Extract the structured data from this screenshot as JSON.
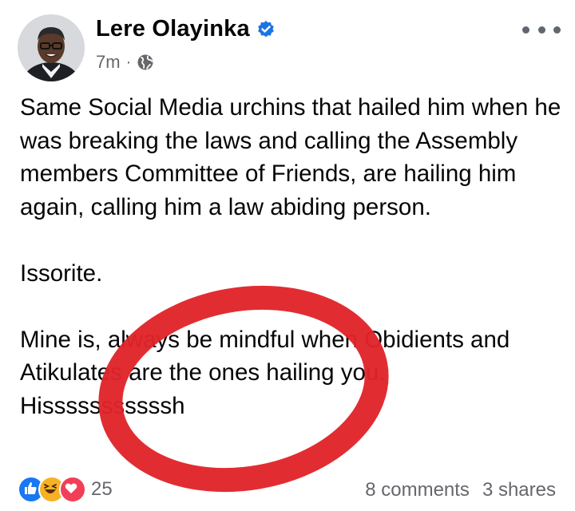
{
  "post": {
    "author": "Lere Olayinka",
    "time": "7m",
    "separator": "·",
    "paragraphs": [
      "Same Social Media urchins that hailed him when he was breaking the laws and calling the Assembly members Committee of Friends,  are hailing him again,  calling him a law abiding person.",
      "Issorite.",
      "Mine is, always be mindful when Obidients and Atikulates are the ones hailing you.\nHisssssssssssh"
    ],
    "reaction_count": "25",
    "comments": "8 comments",
    "shares": "3 shares",
    "reactions": [
      "like-icon",
      "haha-icon",
      "love-icon"
    ],
    "colors": {
      "verified": "#1b74e4",
      "like": "#1877f2",
      "love": "#f33e58",
      "haha": "#f7b125",
      "annotation": "#e0242a"
    }
  }
}
